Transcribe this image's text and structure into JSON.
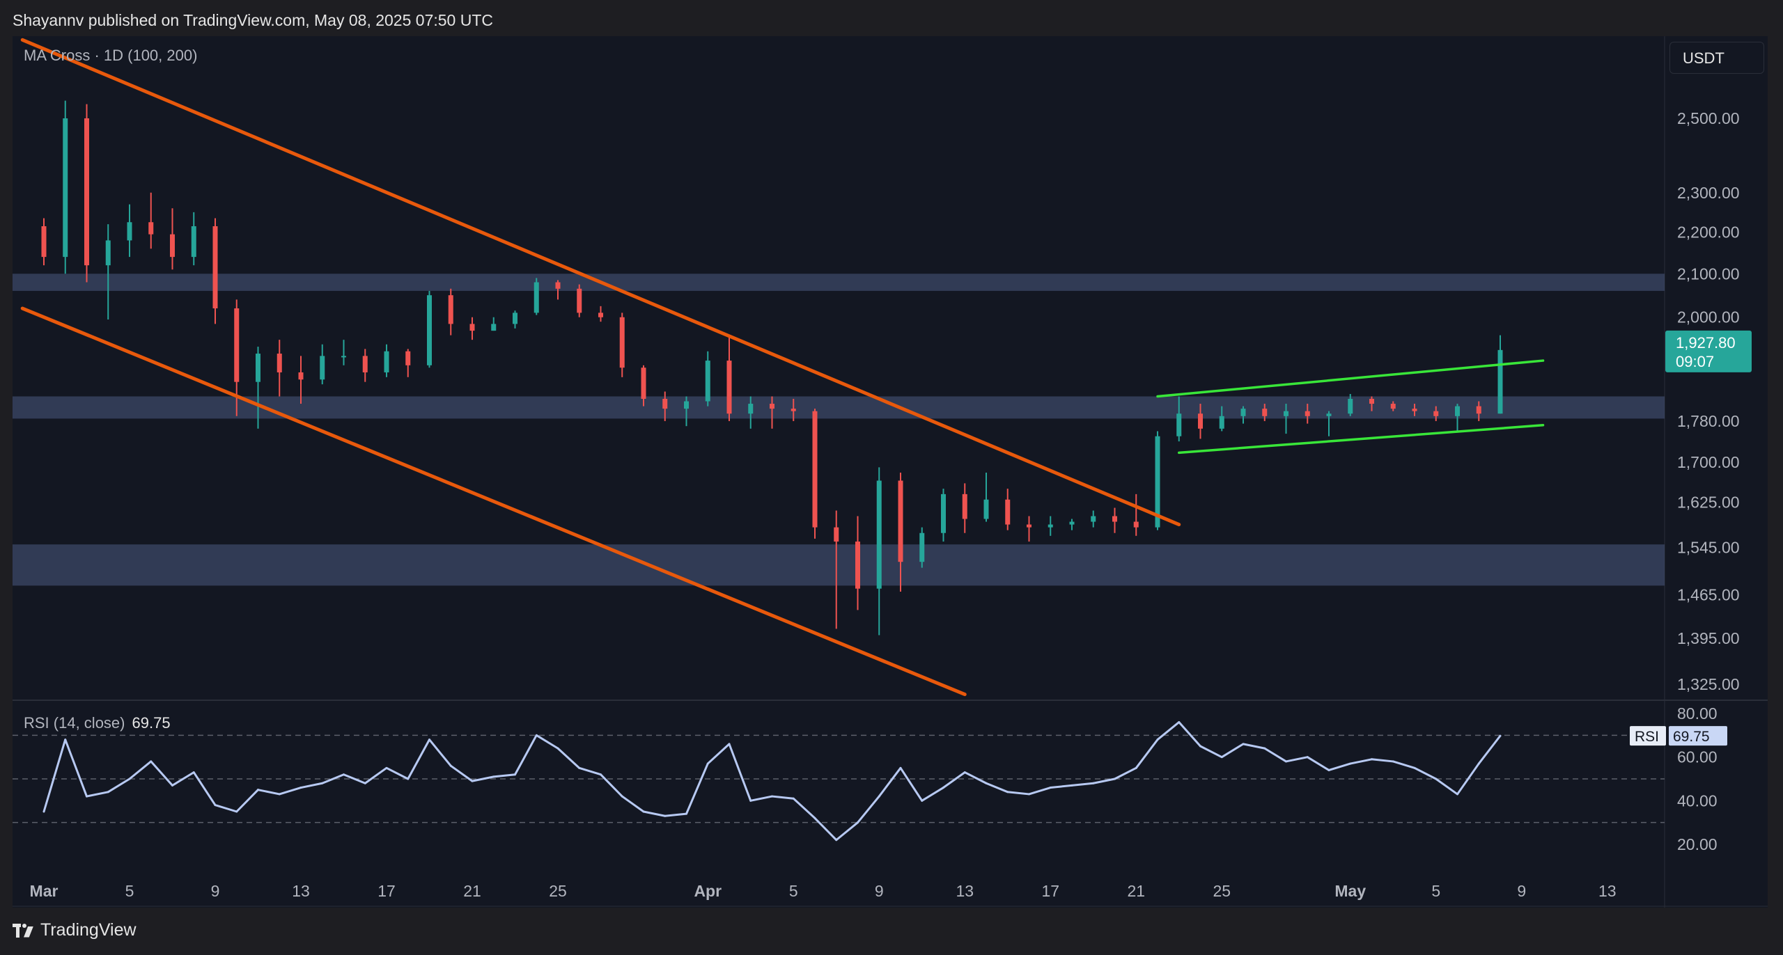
{
  "header": {
    "published_text": "Shayannv published on TradingView.com, May 08, 2025 07:50 UTC"
  },
  "footer": {
    "brand": "TradingView"
  },
  "toolbar": {
    "currency": "USDT"
  },
  "indicators": {
    "ma_label": "MA Cross · 1D (100, 200)",
    "rsi_label": "RSI (14, close)",
    "rsi_value": "69.75",
    "rsi_tag": "RSI"
  },
  "price_tag": {
    "price": "1,927.80",
    "countdown": "09:07"
  },
  "colors": {
    "background": "#131722",
    "up": "#26a69a",
    "down": "#ef5350",
    "channel": "#e8590c",
    "wedge": "#39e639",
    "zone": "#4a5a80",
    "rsi_line": "#b7c9f2",
    "price_tag": "#26a69a"
  },
  "chart_data": [
    {
      "type": "candlestick",
      "symbol_pair": "USDT",
      "y_scale": "log",
      "price_axis_ticks": [
        "2,500.00",
        "2,300.00",
        "2,200.00",
        "2,100.00",
        "2,000.00",
        "1,780.00",
        "1,700.00",
        "1,625.00",
        "1,545.00",
        "1,465.00",
        "1,395.00",
        "1,325.00"
      ],
      "time_axis_ticks": [
        "Mar",
        "5",
        "9",
        "13",
        "17",
        "21",
        "25",
        "Apr",
        "5",
        "9",
        "13",
        "17",
        "21",
        "25",
        "May",
        "5",
        "9",
        "13"
      ],
      "time_axis_dates": [
        "2025-03-01",
        "2025-03-05",
        "2025-03-09",
        "2025-03-13",
        "2025-03-17",
        "2025-03-21",
        "2025-03-25",
        "2025-04-01",
        "2025-04-05",
        "2025-04-09",
        "2025-04-13",
        "2025-04-17",
        "2025-04-21",
        "2025-04-25",
        "2025-05-01",
        "2025-05-05",
        "2025-05-09",
        "2025-05-13"
      ],
      "candles": [
        {
          "d": "2025-03-01",
          "o": 2215,
          "h": 2235,
          "l": 2120,
          "c": 2140
        },
        {
          "d": "2025-03-02",
          "o": 2140,
          "h": 2550,
          "l": 2100,
          "c": 2500
        },
        {
          "d": "2025-03-03",
          "o": 2500,
          "h": 2540,
          "l": 2080,
          "c": 2120
        },
        {
          "d": "2025-03-04",
          "o": 2120,
          "h": 2220,
          "l": 1995,
          "c": 2180
        },
        {
          "d": "2025-03-05",
          "o": 2180,
          "h": 2270,
          "l": 2140,
          "c": 2225
        },
        {
          "d": "2025-03-06",
          "o": 2225,
          "h": 2300,
          "l": 2160,
          "c": 2195
        },
        {
          "d": "2025-03-07",
          "o": 2195,
          "h": 2260,
          "l": 2110,
          "c": 2140
        },
        {
          "d": "2025-03-08",
          "o": 2140,
          "h": 2250,
          "l": 2120,
          "c": 2215
        },
        {
          "d": "2025-03-09",
          "o": 2215,
          "h": 2235,
          "l": 1985,
          "c": 2020
        },
        {
          "d": "2025-03-10",
          "o": 2020,
          "h": 2040,
          "l": 1790,
          "c": 1860
        },
        {
          "d": "2025-03-11",
          "o": 1860,
          "h": 1935,
          "l": 1765,
          "c": 1920
        },
        {
          "d": "2025-03-12",
          "o": 1920,
          "h": 1950,
          "l": 1830,
          "c": 1880
        },
        {
          "d": "2025-03-13",
          "o": 1880,
          "h": 1915,
          "l": 1815,
          "c": 1865
        },
        {
          "d": "2025-03-14",
          "o": 1865,
          "h": 1940,
          "l": 1855,
          "c": 1915
        },
        {
          "d": "2025-03-15",
          "o": 1915,
          "h": 1950,
          "l": 1895,
          "c": 1915
        },
        {
          "d": "2025-03-16",
          "o": 1915,
          "h": 1930,
          "l": 1860,
          "c": 1880
        },
        {
          "d": "2025-03-17",
          "o": 1880,
          "h": 1940,
          "l": 1870,
          "c": 1925
        },
        {
          "d": "2025-03-18",
          "o": 1925,
          "h": 1930,
          "l": 1870,
          "c": 1895
        },
        {
          "d": "2025-03-19",
          "o": 1895,
          "h": 2060,
          "l": 1890,
          "c": 2050
        },
        {
          "d": "2025-03-20",
          "o": 2050,
          "h": 2065,
          "l": 1960,
          "c": 1985
        },
        {
          "d": "2025-03-21",
          "o": 1985,
          "h": 2000,
          "l": 1950,
          "c": 1970
        },
        {
          "d": "2025-03-22",
          "o": 1970,
          "h": 2000,
          "l": 1970,
          "c": 1985
        },
        {
          "d": "2025-03-23",
          "o": 1985,
          "h": 2015,
          "l": 1975,
          "c": 2010
        },
        {
          "d": "2025-03-24",
          "o": 2010,
          "h": 2090,
          "l": 2005,
          "c": 2080
        },
        {
          "d": "2025-03-25",
          "o": 2080,
          "h": 2085,
          "l": 2040,
          "c": 2065
        },
        {
          "d": "2025-03-26",
          "o": 2065,
          "h": 2075,
          "l": 2000,
          "c": 2010
        },
        {
          "d": "2025-03-27",
          "o": 2010,
          "h": 2025,
          "l": 1990,
          "c": 2000
        },
        {
          "d": "2025-03-28",
          "o": 2000,
          "h": 2010,
          "l": 1870,
          "c": 1890
        },
        {
          "d": "2025-03-29",
          "o": 1890,
          "h": 1895,
          "l": 1810,
          "c": 1825
        },
        {
          "d": "2025-03-30",
          "o": 1825,
          "h": 1840,
          "l": 1780,
          "c": 1805
        },
        {
          "d": "2025-03-31",
          "o": 1805,
          "h": 1830,
          "l": 1770,
          "c": 1820
        },
        {
          "d": "2025-04-01",
          "o": 1820,
          "h": 1925,
          "l": 1810,
          "c": 1905
        },
        {
          "d": "2025-04-02",
          "o": 1905,
          "h": 1955,
          "l": 1780,
          "c": 1795
        },
        {
          "d": "2025-04-03",
          "o": 1795,
          "h": 1830,
          "l": 1765,
          "c": 1815
        },
        {
          "d": "2025-04-04",
          "o": 1815,
          "h": 1830,
          "l": 1765,
          "c": 1805
        },
        {
          "d": "2025-04-05",
          "o": 1805,
          "h": 1825,
          "l": 1780,
          "c": 1800
        },
        {
          "d": "2025-04-06",
          "o": 1800,
          "h": 1805,
          "l": 1560,
          "c": 1580
        },
        {
          "d": "2025-04-07",
          "o": 1580,
          "h": 1610,
          "l": 1410,
          "c": 1555
        },
        {
          "d": "2025-04-08",
          "o": 1555,
          "h": 1600,
          "l": 1440,
          "c": 1475
        },
        {
          "d": "2025-04-09",
          "o": 1475,
          "h": 1690,
          "l": 1400,
          "c": 1665
        },
        {
          "d": "2025-04-10",
          "o": 1665,
          "h": 1680,
          "l": 1470,
          "c": 1520
        },
        {
          "d": "2025-04-11",
          "o": 1520,
          "h": 1580,
          "l": 1510,
          "c": 1570
        },
        {
          "d": "2025-04-12",
          "o": 1570,
          "h": 1650,
          "l": 1555,
          "c": 1640
        },
        {
          "d": "2025-04-13",
          "o": 1640,
          "h": 1660,
          "l": 1570,
          "c": 1595
        },
        {
          "d": "2025-04-14",
          "o": 1595,
          "h": 1680,
          "l": 1590,
          "c": 1630
        },
        {
          "d": "2025-04-15",
          "o": 1630,
          "h": 1650,
          "l": 1575,
          "c": 1585
        },
        {
          "d": "2025-04-16",
          "o": 1585,
          "h": 1600,
          "l": 1555,
          "c": 1580
        },
        {
          "d": "2025-04-17",
          "o": 1580,
          "h": 1600,
          "l": 1565,
          "c": 1585
        },
        {
          "d": "2025-04-18",
          "o": 1585,
          "h": 1595,
          "l": 1575,
          "c": 1590
        },
        {
          "d": "2025-04-19",
          "o": 1590,
          "h": 1610,
          "l": 1580,
          "c": 1600
        },
        {
          "d": "2025-04-20",
          "o": 1600,
          "h": 1615,
          "l": 1570,
          "c": 1590
        },
        {
          "d": "2025-04-21",
          "o": 1590,
          "h": 1640,
          "l": 1565,
          "c": 1580
        },
        {
          "d": "2025-04-22",
          "o": 1580,
          "h": 1760,
          "l": 1575,
          "c": 1750
        },
        {
          "d": "2025-04-23",
          "o": 1750,
          "h": 1830,
          "l": 1740,
          "c": 1795
        },
        {
          "d": "2025-04-24",
          "o": 1795,
          "h": 1815,
          "l": 1745,
          "c": 1765
        },
        {
          "d": "2025-04-25",
          "o": 1765,
          "h": 1810,
          "l": 1760,
          "c": 1790
        },
        {
          "d": "2025-04-26",
          "o": 1790,
          "h": 1810,
          "l": 1775,
          "c": 1805
        },
        {
          "d": "2025-04-27",
          "o": 1805,
          "h": 1815,
          "l": 1780,
          "c": 1790
        },
        {
          "d": "2025-04-28",
          "o": 1790,
          "h": 1815,
          "l": 1755,
          "c": 1800
        },
        {
          "d": "2025-04-29",
          "o": 1800,
          "h": 1815,
          "l": 1775,
          "c": 1790
        },
        {
          "d": "2025-04-30",
          "o": 1790,
          "h": 1800,
          "l": 1750,
          "c": 1795
        },
        {
          "d": "2025-05-01",
          "o": 1795,
          "h": 1835,
          "l": 1790,
          "c": 1825
        },
        {
          "d": "2025-05-02",
          "o": 1825,
          "h": 1830,
          "l": 1800,
          "c": 1815
        },
        {
          "d": "2025-05-03",
          "o": 1815,
          "h": 1820,
          "l": 1800,
          "c": 1805
        },
        {
          "d": "2025-05-04",
          "o": 1805,
          "h": 1815,
          "l": 1790,
          "c": 1800
        },
        {
          "d": "2025-05-05",
          "o": 1800,
          "h": 1810,
          "l": 1780,
          "c": 1790
        },
        {
          "d": "2025-05-06",
          "o": 1790,
          "h": 1815,
          "l": 1760,
          "c": 1810
        },
        {
          "d": "2025-05-07",
          "o": 1810,
          "h": 1820,
          "l": 1780,
          "c": 1795
        },
        {
          "d": "2025-05-08",
          "o": 1795,
          "h": 1960,
          "l": 1795,
          "c": 1927.8
        }
      ],
      "zones": [
        {
          "from": 2060,
          "to": 2100
        },
        {
          "from": 1785,
          "to": 1830
        },
        {
          "from": 1480,
          "to": 1550
        }
      ],
      "trendlines": [
        {
          "role": "channel-upper",
          "from": {
            "d": "2025-02-28",
            "p": 2730
          },
          "to": {
            "d": "2025-04-23",
            "p": 1585
          }
        },
        {
          "role": "channel-lower",
          "from": {
            "d": "2025-02-28",
            "p": 2020
          },
          "to": {
            "d": "2025-04-13",
            "p": 1310
          }
        },
        {
          "role": "wedge-upper",
          "from": {
            "d": "2025-04-22",
            "p": 1830
          },
          "to": {
            "d": "2025-05-10",
            "p": 1905
          }
        },
        {
          "role": "wedge-lower",
          "from": {
            "d": "2025-04-23",
            "p": 1718
          },
          "to": {
            "d": "2025-05-10",
            "p": 1772
          }
        }
      ],
      "last_price": 1927.8
    },
    {
      "type": "line",
      "indicator": "RSI (14, close)",
      "y_axis_ticks": [
        "80.00",
        "60.00",
        "40.00",
        "20.00"
      ],
      "ylim": [
        8,
        85
      ],
      "levels": [
        70,
        50,
        30
      ],
      "x": [
        "2025-03-01",
        "2025-03-02",
        "2025-03-03",
        "2025-03-04",
        "2025-03-05",
        "2025-03-06",
        "2025-03-07",
        "2025-03-08",
        "2025-03-09",
        "2025-03-10",
        "2025-03-11",
        "2025-03-12",
        "2025-03-13",
        "2025-03-14",
        "2025-03-15",
        "2025-03-16",
        "2025-03-17",
        "2025-03-18",
        "2025-03-19",
        "2025-03-20",
        "2025-03-21",
        "2025-03-22",
        "2025-03-23",
        "2025-03-24",
        "2025-03-25",
        "2025-03-26",
        "2025-03-27",
        "2025-03-28",
        "2025-03-29",
        "2025-03-30",
        "2025-03-31",
        "2025-04-01",
        "2025-04-02",
        "2025-04-03",
        "2025-04-04",
        "2025-04-05",
        "2025-04-06",
        "2025-04-07",
        "2025-04-08",
        "2025-04-09",
        "2025-04-10",
        "2025-04-11",
        "2025-04-12",
        "2025-04-13",
        "2025-04-14",
        "2025-04-15",
        "2025-04-16",
        "2025-04-17",
        "2025-04-18",
        "2025-04-19",
        "2025-04-20",
        "2025-04-21",
        "2025-04-22",
        "2025-04-23",
        "2025-04-24",
        "2025-04-25",
        "2025-04-26",
        "2025-04-27",
        "2025-04-28",
        "2025-04-29",
        "2025-04-30",
        "2025-05-01",
        "2025-05-02",
        "2025-05-03",
        "2025-05-04",
        "2025-05-05",
        "2025-05-06",
        "2025-05-07",
        "2025-05-08"
      ],
      "values": [
        35,
        68,
        42,
        44,
        50,
        58,
        47,
        53,
        38,
        35,
        45,
        43,
        46,
        48,
        52,
        48,
        55,
        50,
        68,
        56,
        49,
        51,
        52,
        70,
        64,
        55,
        52,
        42,
        35,
        33,
        34,
        57,
        66,
        40,
        42,
        41,
        32,
        22,
        30,
        42,
        55,
        40,
        46,
        53,
        48,
        44,
        43,
        46,
        47,
        48,
        50,
        55,
        68,
        76,
        65,
        60,
        66,
        64,
        58,
        60,
        54,
        57,
        59,
        58,
        55,
        50,
        43,
        57,
        69.75
      ]
    }
  ]
}
